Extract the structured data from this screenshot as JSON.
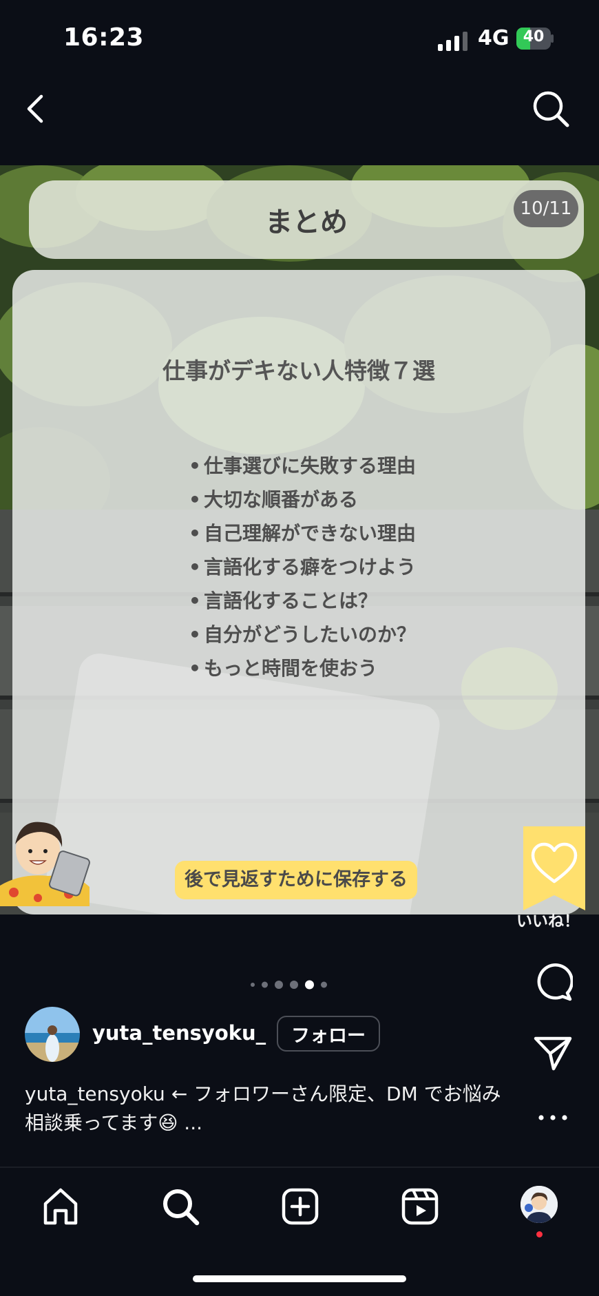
{
  "status_bar": {
    "time": "16:23",
    "network": "4G",
    "battery": "40",
    "battery_level": 0.4
  },
  "header": {
    "back_icon": "chevron-left-icon",
    "search_icon": "search-icon"
  },
  "slide": {
    "title": "まとめ",
    "page_indicator": "10/11",
    "heading": "仕事がデキない人特徴７選",
    "bullets": [
      "仕事選びに失敗する理由",
      "大切な順番がある",
      "自己理解ができない理由",
      "言語化する癖をつけよう",
      "言語化することは？",
      "自分がどうしたいのか？",
      "もっと時間を使おう"
    ],
    "save_prompt": "後で見返すために保存する",
    "like_label": "いいね！"
  },
  "carousel": {
    "total_dots": 6,
    "active_index": 4
  },
  "post": {
    "username": "yuta_tensyoku_",
    "follow_label": "フォロー",
    "caption": "yuta_tensyoku ← フォロワーさん限定、DM でお悩み相談乗ってます😆 ..."
  },
  "actions": [
    "comment-icon",
    "share-icon",
    "more-icon"
  ],
  "bottom_nav": [
    "home-icon",
    "search-icon",
    "create-icon",
    "reels-icon",
    "profile-avatar"
  ],
  "colors": {
    "background": "#0b0e16",
    "save_pill": "#ffe06e",
    "like_ribbon": "#ffe06e",
    "battery_green": "#32c957",
    "notification_dot": "#ff3040"
  }
}
